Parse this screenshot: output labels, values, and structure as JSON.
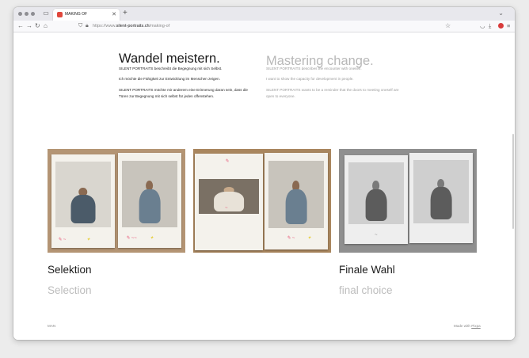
{
  "browser": {
    "tab_title": "MAKING OF",
    "url_host": "silent-portraits.ch",
    "url_prefix": "https://www.",
    "url_path": "/making-of"
  },
  "texts": {
    "heading_de": "Wandel meistern.",
    "heading_en": "Mastering change.",
    "de_p1": "SILENT PORTRAITS beschreibt die Begegnung mit sich Selbst.",
    "de_p2": "Ich möchte die Fähigkeit zur Entwicklung im Menschen zeigen.",
    "de_p3": "SILENT PORTRAITS möchte mir anderem eine Erinnerung daran sein, dass die Türen zur Begegnung mit sich selbst für jeden offenstehen.",
    "en_p1": "SILENT PORTRAITS describes the encounter with oneself.",
    "en_p2": "I want to show the capacity for development in people.",
    "en_p3": "SILENT PORTRAITS wants to be a reminder that the doors to meeting oneself are open to everyone."
  },
  "captions": {
    "selection_de": "Selektion",
    "selection_en": "Selection",
    "final_de": "Finale Wahl",
    "final_en": "final choice"
  },
  "footer": {
    "left": "MAN",
    "right_prefix": "Made with",
    "right_link": "Pixpa"
  },
  "colors": {
    "accent_favicon": "#e0473c",
    "heading_dark": "#1b1b1b",
    "heading_light": "#b8b8b8"
  },
  "icons": [
    "close-icon",
    "plus-icon",
    "back-icon",
    "forward-icon",
    "reload-icon",
    "home-icon",
    "shield-icon",
    "lock-icon",
    "star-icon",
    "pocket-icon",
    "download-icon",
    "extension-icon",
    "menu-icon"
  ]
}
